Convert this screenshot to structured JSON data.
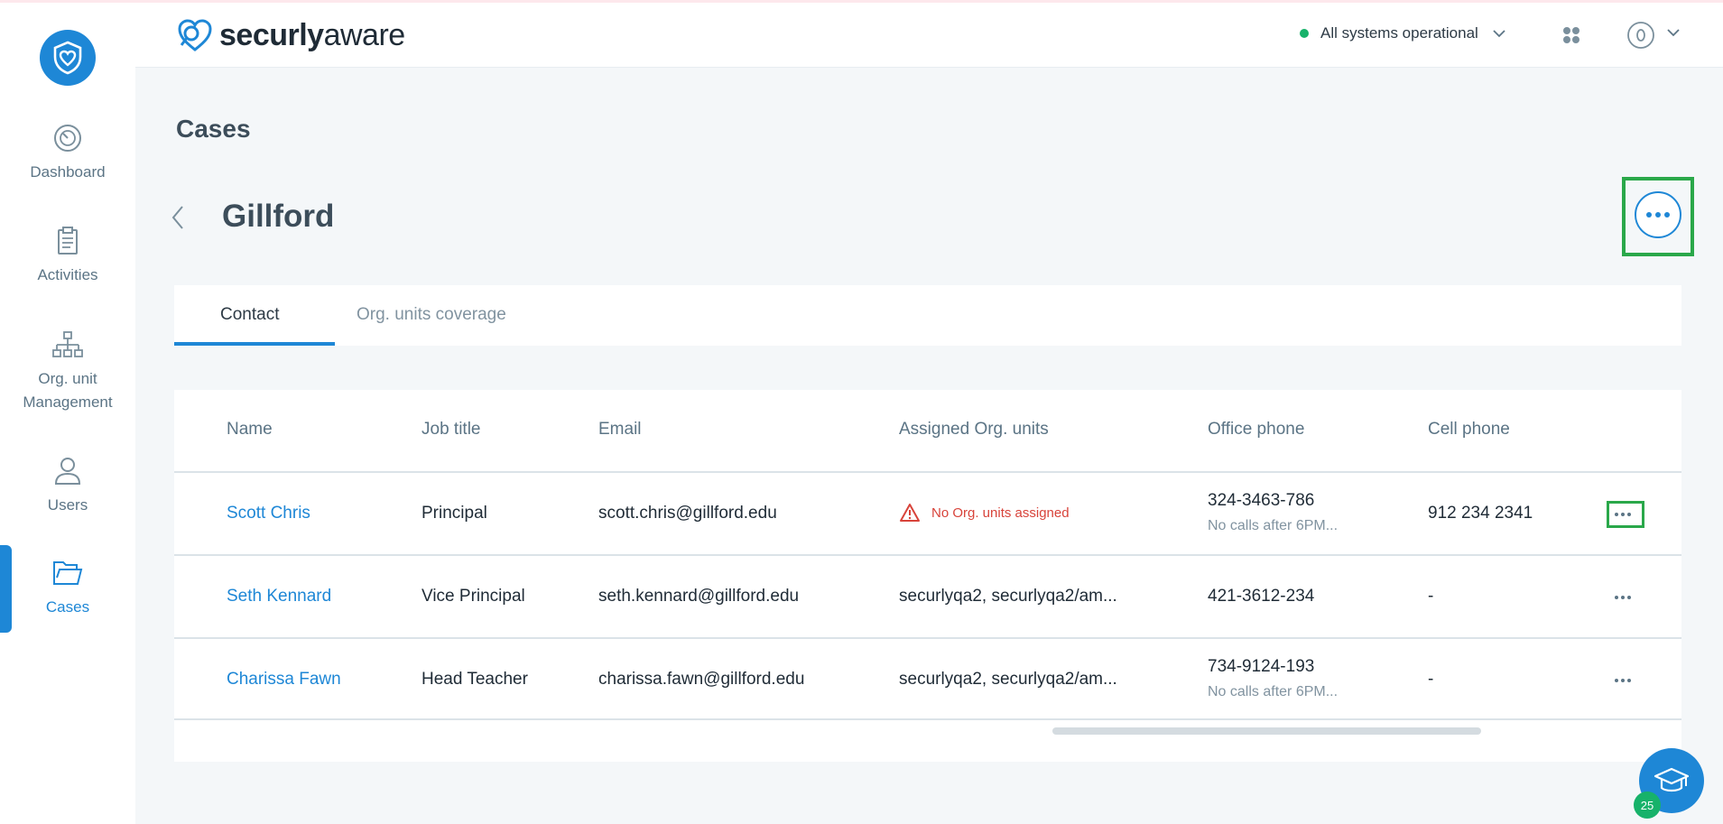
{
  "app": {
    "brand_part1": "securly",
    "brand_part2": "aware",
    "status_text": "All systems operational",
    "status_color": "#17b26a",
    "accent_color": "#1e87d6"
  },
  "sidebar": {
    "items": [
      {
        "label": "Dashboard",
        "icon": "gauge-icon"
      },
      {
        "label": "Activities",
        "icon": "clipboard-icon"
      },
      {
        "label_line1": "Org. unit",
        "label_line2": "Management",
        "icon": "org-chart-icon"
      },
      {
        "label": "Users",
        "icon": "user-icon"
      },
      {
        "label": "Cases",
        "icon": "folder-icon",
        "active": true
      }
    ]
  },
  "page": {
    "title": "Cases",
    "case_name": "Gillford"
  },
  "tabs": [
    {
      "label": "Contact",
      "active": true
    },
    {
      "label": "Org. units coverage",
      "active": false
    }
  ],
  "table": {
    "headers": [
      "Name",
      "Job title",
      "Email",
      "Assigned Org. units",
      "Office phone",
      "Cell phone"
    ],
    "rows": [
      {
        "name": "Scott Chris",
        "job": "Principal",
        "email": "scott.chris@gillford.edu",
        "org_units": "No Org. units assigned",
        "org_warning": true,
        "office_phone": "324-3463-786",
        "office_note": "No calls after 6PM...",
        "cell_phone": "912 234 2341"
      },
      {
        "name": "Seth Kennard",
        "job": "Vice Principal",
        "email": "seth.kennard@gillford.edu",
        "org_units": "securlyqa2, securlyqa2/am...",
        "org_warning": false,
        "office_phone": "421-3612-234",
        "office_note": "",
        "cell_phone": "-"
      },
      {
        "name": "Charissa Fawn",
        "job": "Head Teacher",
        "email": "charissa.fawn@gillford.edu",
        "org_units": "securlyqa2, securlyqa2/am...",
        "org_warning": false,
        "office_phone": "734-9124-193",
        "office_note": "No calls after 6PM...",
        "cell_phone": "-"
      }
    ]
  },
  "help": {
    "badge_count": "25"
  }
}
